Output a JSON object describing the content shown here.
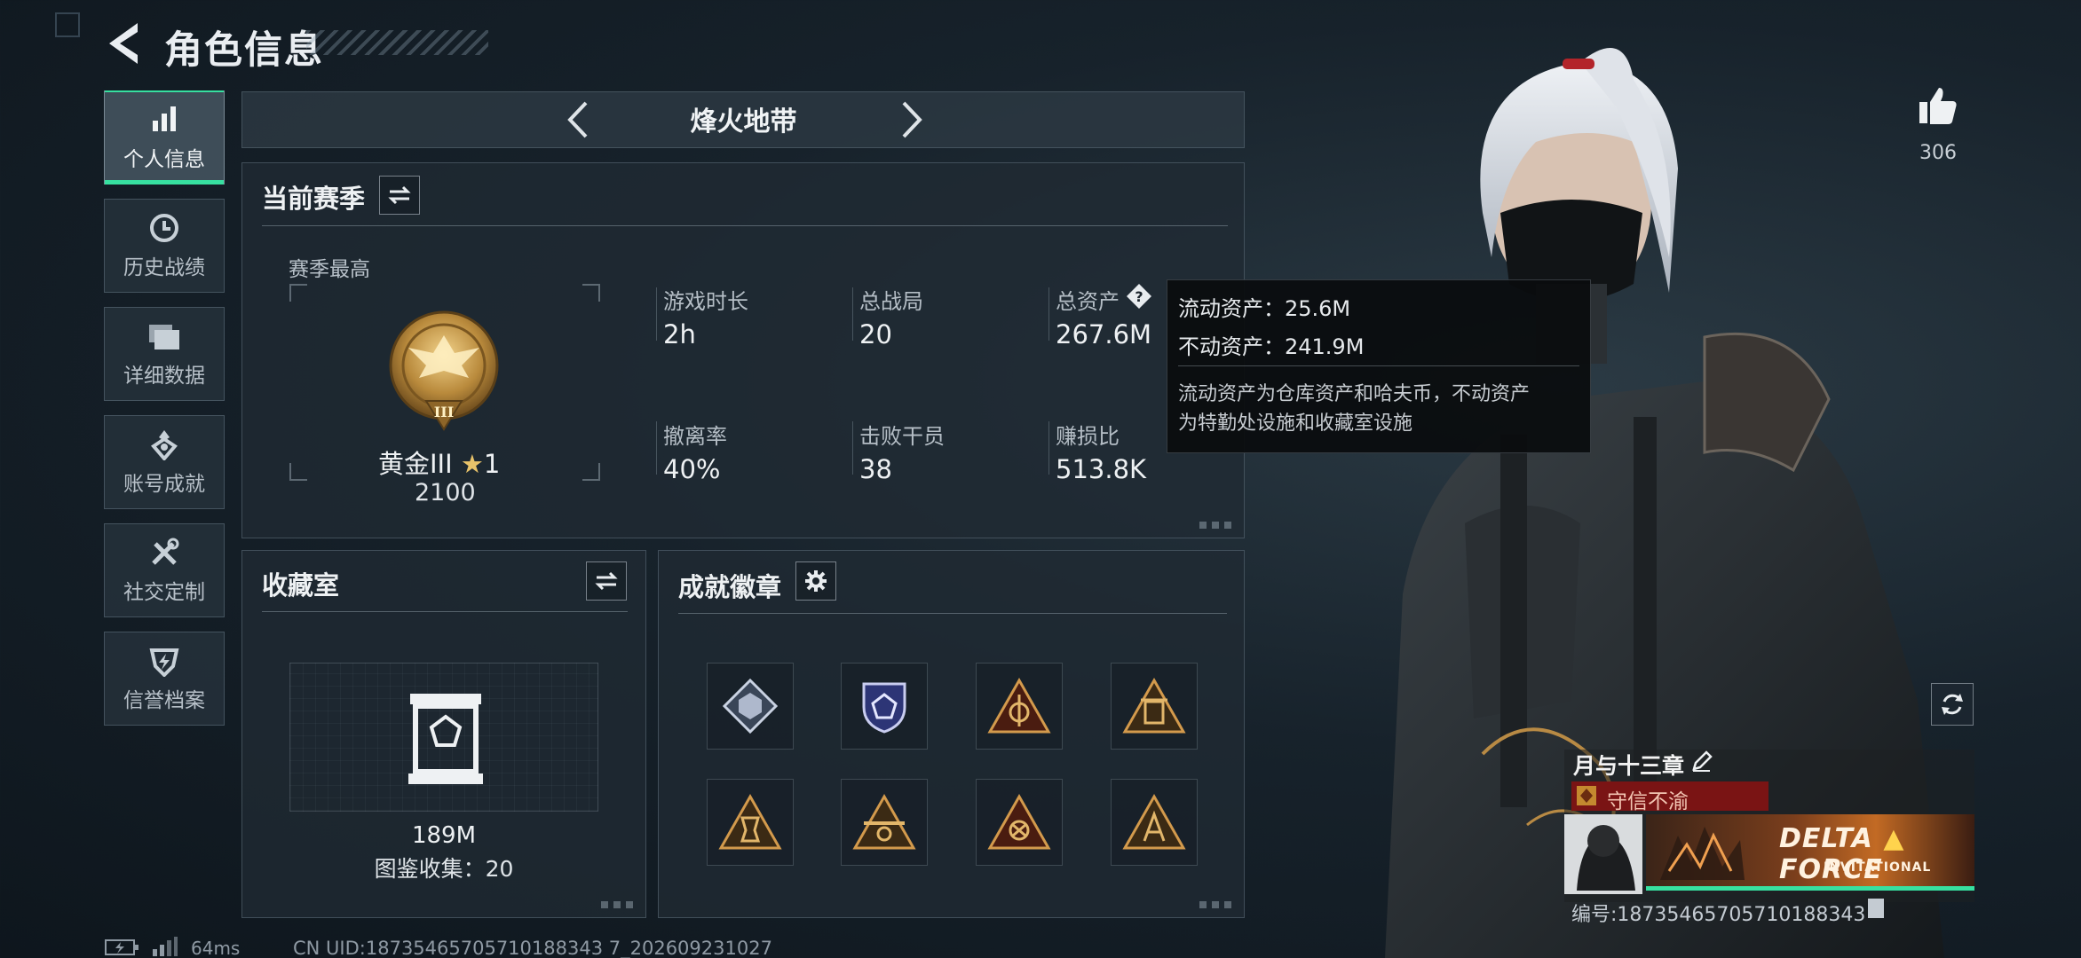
{
  "header": {
    "title": "角色信息"
  },
  "sidebar": {
    "items": [
      {
        "label": "个人信息",
        "active": true,
        "icon": "bar-chart-icon"
      },
      {
        "label": "历史战绩",
        "active": false,
        "icon": "clock-icon"
      },
      {
        "label": "详细数据",
        "active": false,
        "icon": "folder-icon"
      },
      {
        "label": "账号成就",
        "active": false,
        "icon": "medal-icon"
      },
      {
        "label": "社交定制",
        "active": false,
        "icon": "tools-icon"
      },
      {
        "label": "信誉档案",
        "active": false,
        "icon": "shield-bolt-icon"
      }
    ]
  },
  "mode": {
    "title": "烽火地带"
  },
  "season": {
    "title": "当前赛季",
    "best_label": "赛季最高",
    "rank_name": "黄金III",
    "rank_stars": "1",
    "rank_score": "2100",
    "stats": [
      {
        "label": "游戏时长",
        "value": "2h"
      },
      {
        "label": "总战局",
        "value": "20"
      },
      {
        "label": "总资产",
        "value": "267.6M"
      },
      {
        "label": "撤离率",
        "value": "40%"
      },
      {
        "label": "击败干员",
        "value": "38"
      },
      {
        "label": "赚损比",
        "value": "513.8K"
      }
    ]
  },
  "tooltip": {
    "liquid": "流动资产：25.6M",
    "fixed": "不动资产：241.9M",
    "note_line1": "流动资产为仓库资产和哈夫币，不动资产",
    "note_line2": "为特勤处设施和收藏室设施"
  },
  "collection": {
    "title": "收藏室",
    "value": "189M",
    "catalog": "图鉴收集：20"
  },
  "badges": {
    "title": "成就徽章",
    "items": [
      {
        "icon": "cube-badge-icon",
        "color": "#8b95a8"
      },
      {
        "icon": "shield-badge-icon",
        "color": "#5a62a8"
      },
      {
        "icon": "triangle-gold-badge-icon",
        "color": "#b78a3a"
      },
      {
        "icon": "triangle-gold-badge-icon",
        "color": "#b78a3a"
      },
      {
        "icon": "triangle-gold-badge-icon",
        "color": "#b78a3a"
      },
      {
        "icon": "triangle-gold-badge-icon",
        "color": "#b78a3a"
      },
      {
        "icon": "triangle-gold-badge-icon",
        "color": "#b78a3a"
      },
      {
        "icon": "triangle-gold-badge-icon",
        "color": "#b78a3a"
      }
    ]
  },
  "profile": {
    "likes": "306",
    "name": "月与十三章",
    "title_badge": "守信不渝",
    "player_id": "编号:18735465705710188343",
    "banner_text_1": "DELTA",
    "banner_text_2": "FORCE",
    "banner_text_3": "INVITATIONAL"
  },
  "status": {
    "ping": "64ms",
    "uid": "CN UID:18735465705710188343 7_202609231027"
  },
  "colors": {
    "accent": "#37e0a0",
    "title_red": "#7a1414",
    "gold": "#b78a3a"
  }
}
